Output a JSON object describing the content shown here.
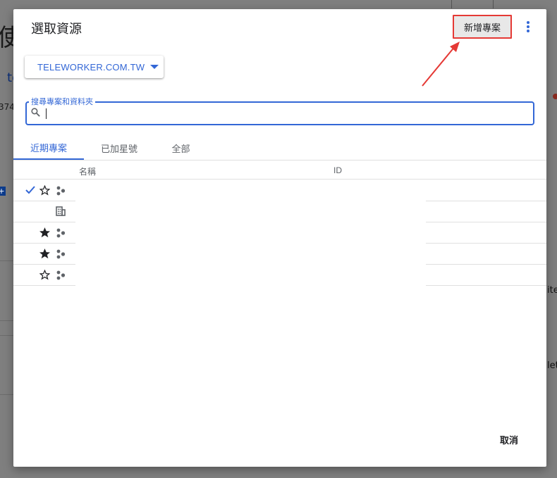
{
  "background": {
    "title_fragment": "使",
    "link_fragment": "te",
    "number_fragment": "374",
    "chip_fragment": "+",
    "right_fragments": [
      "ite",
      "let"
    ]
  },
  "dialog": {
    "title": "選取資源",
    "new_project_label": "新增專案",
    "more_icon": "more-vert-icon",
    "highlight_color": "#e53935",
    "accent_color": "#3367d6"
  },
  "org_select": {
    "value": "TELEWORKER.COM.TW",
    "icon": "caret-down-icon"
  },
  "search": {
    "label": "搜尋專案和資料夾",
    "placeholder": "",
    "value": "",
    "icon": "search-icon"
  },
  "tabs": [
    {
      "label": "近期專案",
      "active": true
    },
    {
      "label": "已加星號",
      "active": false
    },
    {
      "label": "全部",
      "active": false
    }
  ],
  "table": {
    "columns": [
      "名稱",
      "ID"
    ],
    "rows": [
      {
        "selected": true,
        "starred": false,
        "type": "project"
      },
      {
        "selected": false,
        "starred": null,
        "type": "organization"
      },
      {
        "selected": false,
        "starred": true,
        "type": "project"
      },
      {
        "selected": false,
        "starred": true,
        "type": "project"
      },
      {
        "selected": false,
        "starred": false,
        "type": "project"
      }
    ]
  },
  "footer": {
    "cancel_label": "取消"
  }
}
